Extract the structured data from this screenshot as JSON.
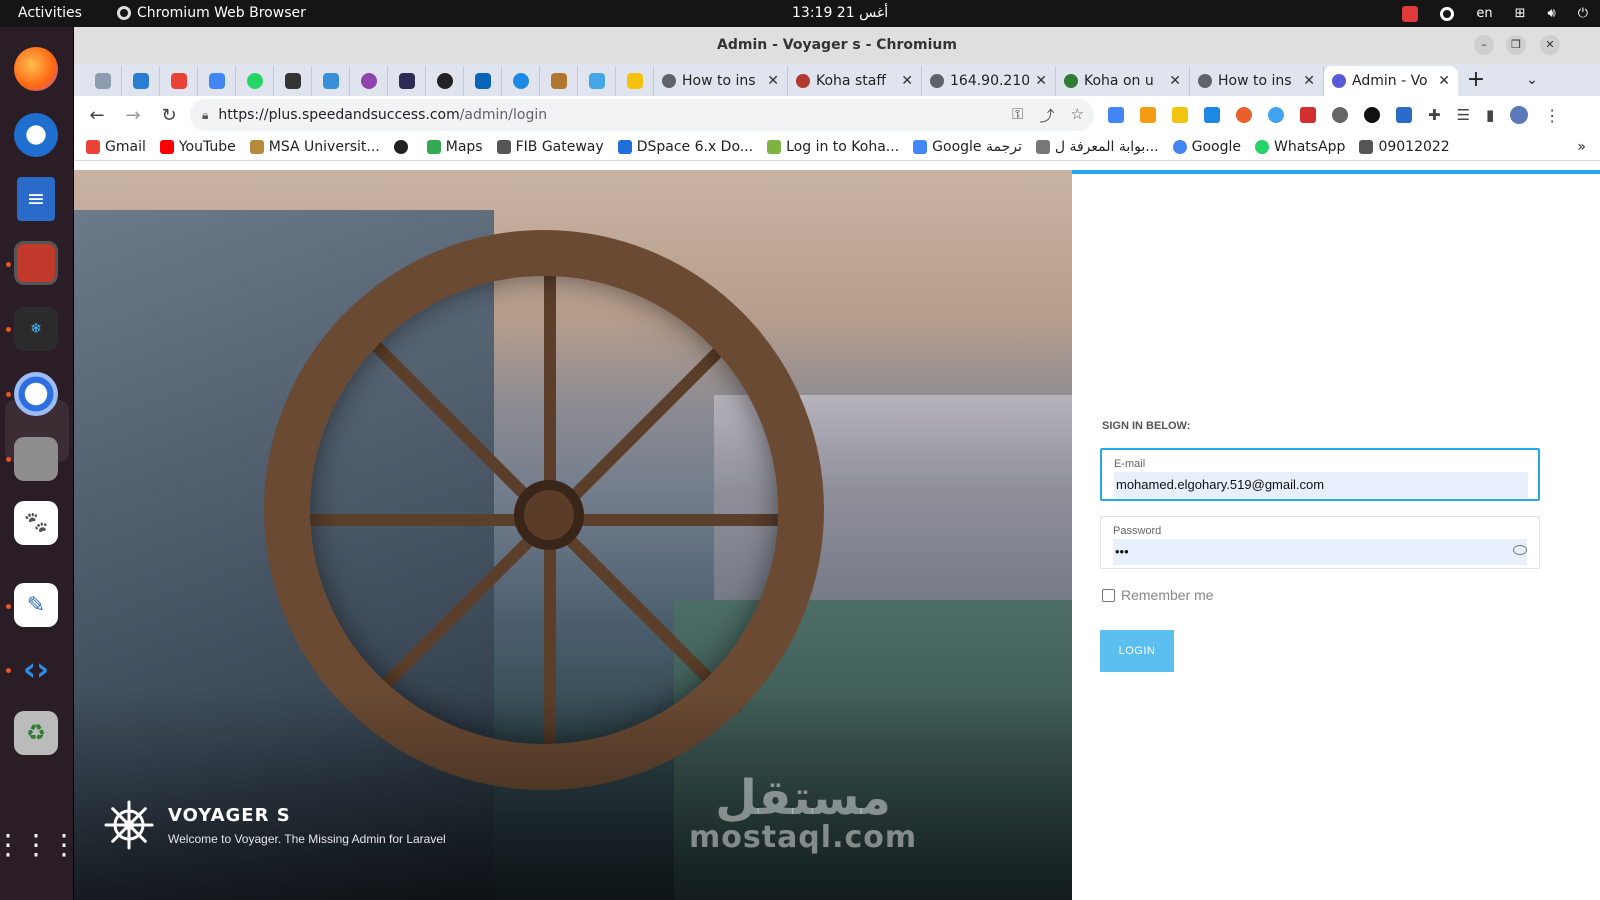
{
  "topbar": {
    "activities": "Activities",
    "app_name": "Chromium Web Browser",
    "clock": "13:19  أغس 21",
    "lang": "en"
  },
  "window": {
    "title": "Admin - Voyager s - Chromium"
  },
  "tabs": [
    {
      "label": "How to ins",
      "fav": "#5f6368"
    },
    {
      "label": "Koha staff",
      "fav": "#b03a2e"
    },
    {
      "label": "164.90.210",
      "fav": "#5f6368"
    },
    {
      "label": "Koha on u",
      "fav": "#2e7d32"
    },
    {
      "label": "How to ins",
      "fav": "#5f6368"
    },
    {
      "label": "Admin - Vo",
      "fav": "#5a5ad6",
      "active": true
    }
  ],
  "address": {
    "host": "https://plus.speedandsuccess.com",
    "path": "/admin/login"
  },
  "bookmarks": [
    {
      "label": "Gmail",
      "color": "#ea4335"
    },
    {
      "label": "YouTube",
      "color": "#ff0000"
    },
    {
      "label": "MSA Universit...",
      "color": "#b58b3b"
    },
    {
      "label": "",
      "color": "#222"
    },
    {
      "label": "Maps",
      "color": "#34a853"
    },
    {
      "label": "FIB Gateway",
      "color": "#555"
    },
    {
      "label": "DSpace 6.x Do...",
      "color": "#1e6fd9"
    },
    {
      "label": "Log in to Koha...",
      "color": "#7cb342"
    },
    {
      "label": "Google ترجمة",
      "color": "#4285f4"
    },
    {
      "label": "بوابة المعرفة ل...",
      "color": "#777"
    },
    {
      "label": "Google",
      "color": "#4285f4"
    },
    {
      "label": "WhatsApp",
      "color": "#25d366"
    },
    {
      "label": "09012022",
      "color": "#555"
    }
  ],
  "login": {
    "sign_in_label": "SIGN IN BELOW:",
    "email_label": "E-mail",
    "email_value": "mohamed.elgohary.519@gmail.com",
    "password_label": "Password",
    "password_value": "•••",
    "remember_label": "Remember me",
    "login_button": "LOGIN"
  },
  "hero": {
    "brand_title": "VOYAGER S",
    "brand_subtitle": "Welcome to Voyager. The Missing Admin for Laravel",
    "watermark_ar": "مستقل",
    "watermark_lat": "mostaql.com"
  },
  "colors": {
    "accent": "#22a7f0",
    "button": "#5bc0f0"
  }
}
